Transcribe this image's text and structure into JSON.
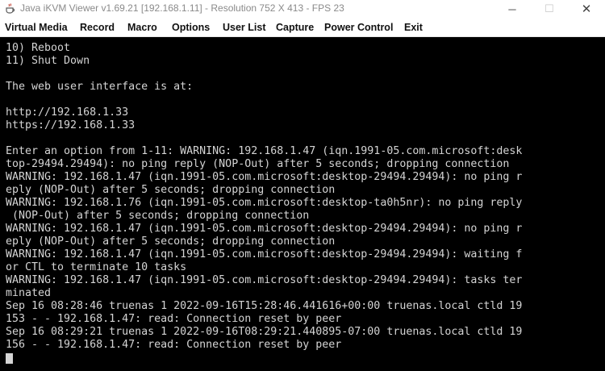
{
  "window": {
    "title": "Java iKVM Viewer v1.69.21 [192.168.1.11]  - Resolution 752 X 413 - FPS 23",
    "app_icon": "java-cup-icon",
    "controls": {
      "minimize": "─",
      "maximize": "☐",
      "close": "✕"
    }
  },
  "menu": {
    "items": [
      {
        "label": "Virtual Media"
      },
      {
        "label": "Record"
      },
      {
        "label": "Macro"
      },
      {
        "label": "Options"
      },
      {
        "label": "User List"
      },
      {
        "label": "Capture"
      },
      {
        "label": "Power Control"
      },
      {
        "label": "Exit"
      }
    ]
  },
  "console": {
    "lines": [
      "10) Reboot",
      "11) Shut Down",
      "",
      "The web user interface is at:",
      "",
      "http://192.168.1.33",
      "https://192.168.1.33",
      "",
      "Enter an option from 1-11: WARNING: 192.168.1.47 (iqn.1991-05.com.microsoft:desk",
      "top-29494.29494): no ping reply (NOP-Out) after 5 seconds; dropping connection",
      "WARNING: 192.168.1.47 (iqn.1991-05.com.microsoft:desktop-29494.29494): no ping r",
      "eply (NOP-Out) after 5 seconds; dropping connection",
      "WARNING: 192.168.1.76 (iqn.1991-05.com.microsoft:desktop-ta0h5nr): no ping reply",
      " (NOP-Out) after 5 seconds; dropping connection",
      "WARNING: 192.168.1.47 (iqn.1991-05.com.microsoft:desktop-29494.29494): no ping r",
      "eply (NOP-Out) after 5 seconds; dropping connection",
      "WARNING: 192.168.1.47 (iqn.1991-05.com.microsoft:desktop-29494.29494): waiting f",
      "or CTL to terminate 10 tasks",
      "WARNING: 192.168.1.47 (iqn.1991-05.com.microsoft:desktop-29494.29494): tasks ter",
      "minated",
      "Sep 16 08:28:46 truenas 1 2022-09-16T15:28:46.441616+00:00 truenas.local ctld 19",
      "153 - - 192.168.1.47: read: Connection reset by peer",
      "Sep 16 08:29:21 truenas 1 2022-09-16T08:29:21.440895-07:00 truenas.local ctld 19",
      "156 - - 192.168.1.47: read: Connection reset by peer"
    ]
  },
  "colors": {
    "console_bg": "#000000",
    "console_fg": "#d4d4d4",
    "title_fg": "#8a8a8a"
  }
}
